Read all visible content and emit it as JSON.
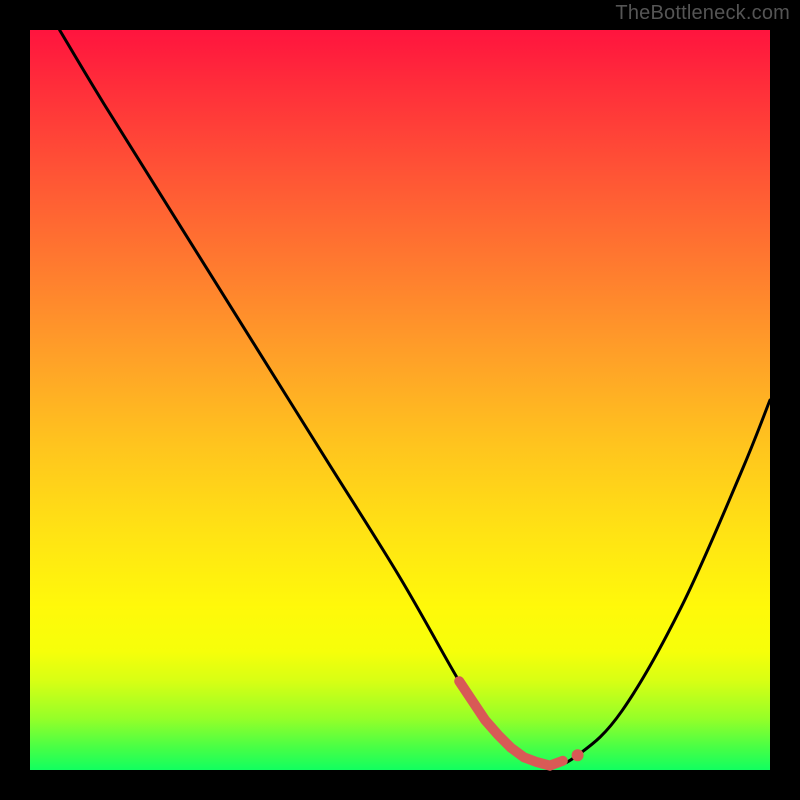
{
  "watermark": "TheBottleneck.com",
  "chart_data": {
    "type": "line",
    "title": "",
    "xlabel": "",
    "ylabel": "",
    "xlim": [
      0,
      100
    ],
    "ylim": [
      0,
      100
    ],
    "grid": false,
    "background_gradient": {
      "top": "#ff143e",
      "bottom": "#11ff60",
      "description": "vertical heat gradient red→orange→yellow→green"
    },
    "series": [
      {
        "name": "bottleneck-curve",
        "x": [
          4,
          10,
          20,
          30,
          40,
          50,
          58,
          62,
          66,
          70,
          74,
          80,
          88,
          96,
          100
        ],
        "y": [
          100,
          90,
          74,
          58,
          42,
          26,
          12,
          6,
          2,
          0.5,
          2,
          8,
          22,
          40,
          50
        ],
        "stroke": "#000000"
      }
    ],
    "highlight": {
      "name": "optimal-range",
      "color": "#d85a56",
      "segment": {
        "x_start": 58,
        "x_end": 72
      },
      "dot": {
        "x": 74,
        "y": 2
      }
    }
  }
}
